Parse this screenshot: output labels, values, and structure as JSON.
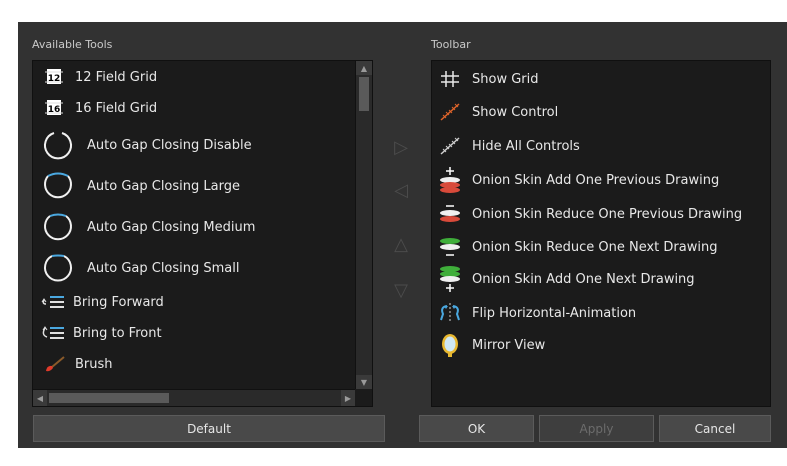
{
  "available_tools": {
    "caption": "Available Tools",
    "items": [
      {
        "label": "12 Field Grid",
        "icon": "grid-12-icon"
      },
      {
        "label": "16 Field Grid",
        "icon": "grid-16-icon"
      },
      {
        "label": "Auto Gap Closing Disable",
        "icon": "gap-disable-icon"
      },
      {
        "label": "Auto Gap Closing Large",
        "icon": "gap-large-icon"
      },
      {
        "label": "Auto Gap Closing Medium",
        "icon": "gap-medium-icon"
      },
      {
        "label": "Auto Gap Closing Small",
        "icon": "gap-small-icon"
      },
      {
        "label": "Bring Forward",
        "icon": "bring-forward-icon"
      },
      {
        "label": "Bring to Front",
        "icon": "bring-to-front-icon"
      },
      {
        "label": "Brush",
        "icon": "brush-icon"
      }
    ],
    "default_label": "Default"
  },
  "toolbar": {
    "caption": "Toolbar",
    "items": [
      {
        "label": "Show Grid",
        "icon": "grid-icon"
      },
      {
        "label": "Show Control",
        "icon": "show-control-icon"
      },
      {
        "label": "Hide All Controls",
        "icon": "hide-controls-icon"
      },
      {
        "label": "Onion Skin Add One Previous Drawing",
        "icon": "onion-add-previous-icon"
      },
      {
        "label": "Onion Skin Reduce One Previous Drawing",
        "icon": "onion-reduce-previous-icon"
      },
      {
        "label": "Onion Skin Reduce One Next Drawing",
        "icon": "onion-reduce-next-icon"
      },
      {
        "label": "Onion Skin Add One Next Drawing",
        "icon": "onion-add-next-icon"
      },
      {
        "label": "Flip Horizontal-Animation",
        "icon": "flip-horizontal-icon"
      },
      {
        "label": "Mirror View",
        "icon": "mirror-view-icon"
      }
    ]
  },
  "transfer_arrows": {
    "add": "▷",
    "remove": "◁",
    "up": "△",
    "down": "▽"
  },
  "buttons": {
    "ok": "OK",
    "apply": "Apply",
    "cancel": "Cancel"
  },
  "colors": {
    "dialog_bg": "#323232",
    "list_bg": "#1b1b1b",
    "onion_red": "#d84a3a",
    "onion_green": "#3fae3a",
    "control_orange": "#e0642a",
    "flip_blue": "#4aa8e0"
  }
}
